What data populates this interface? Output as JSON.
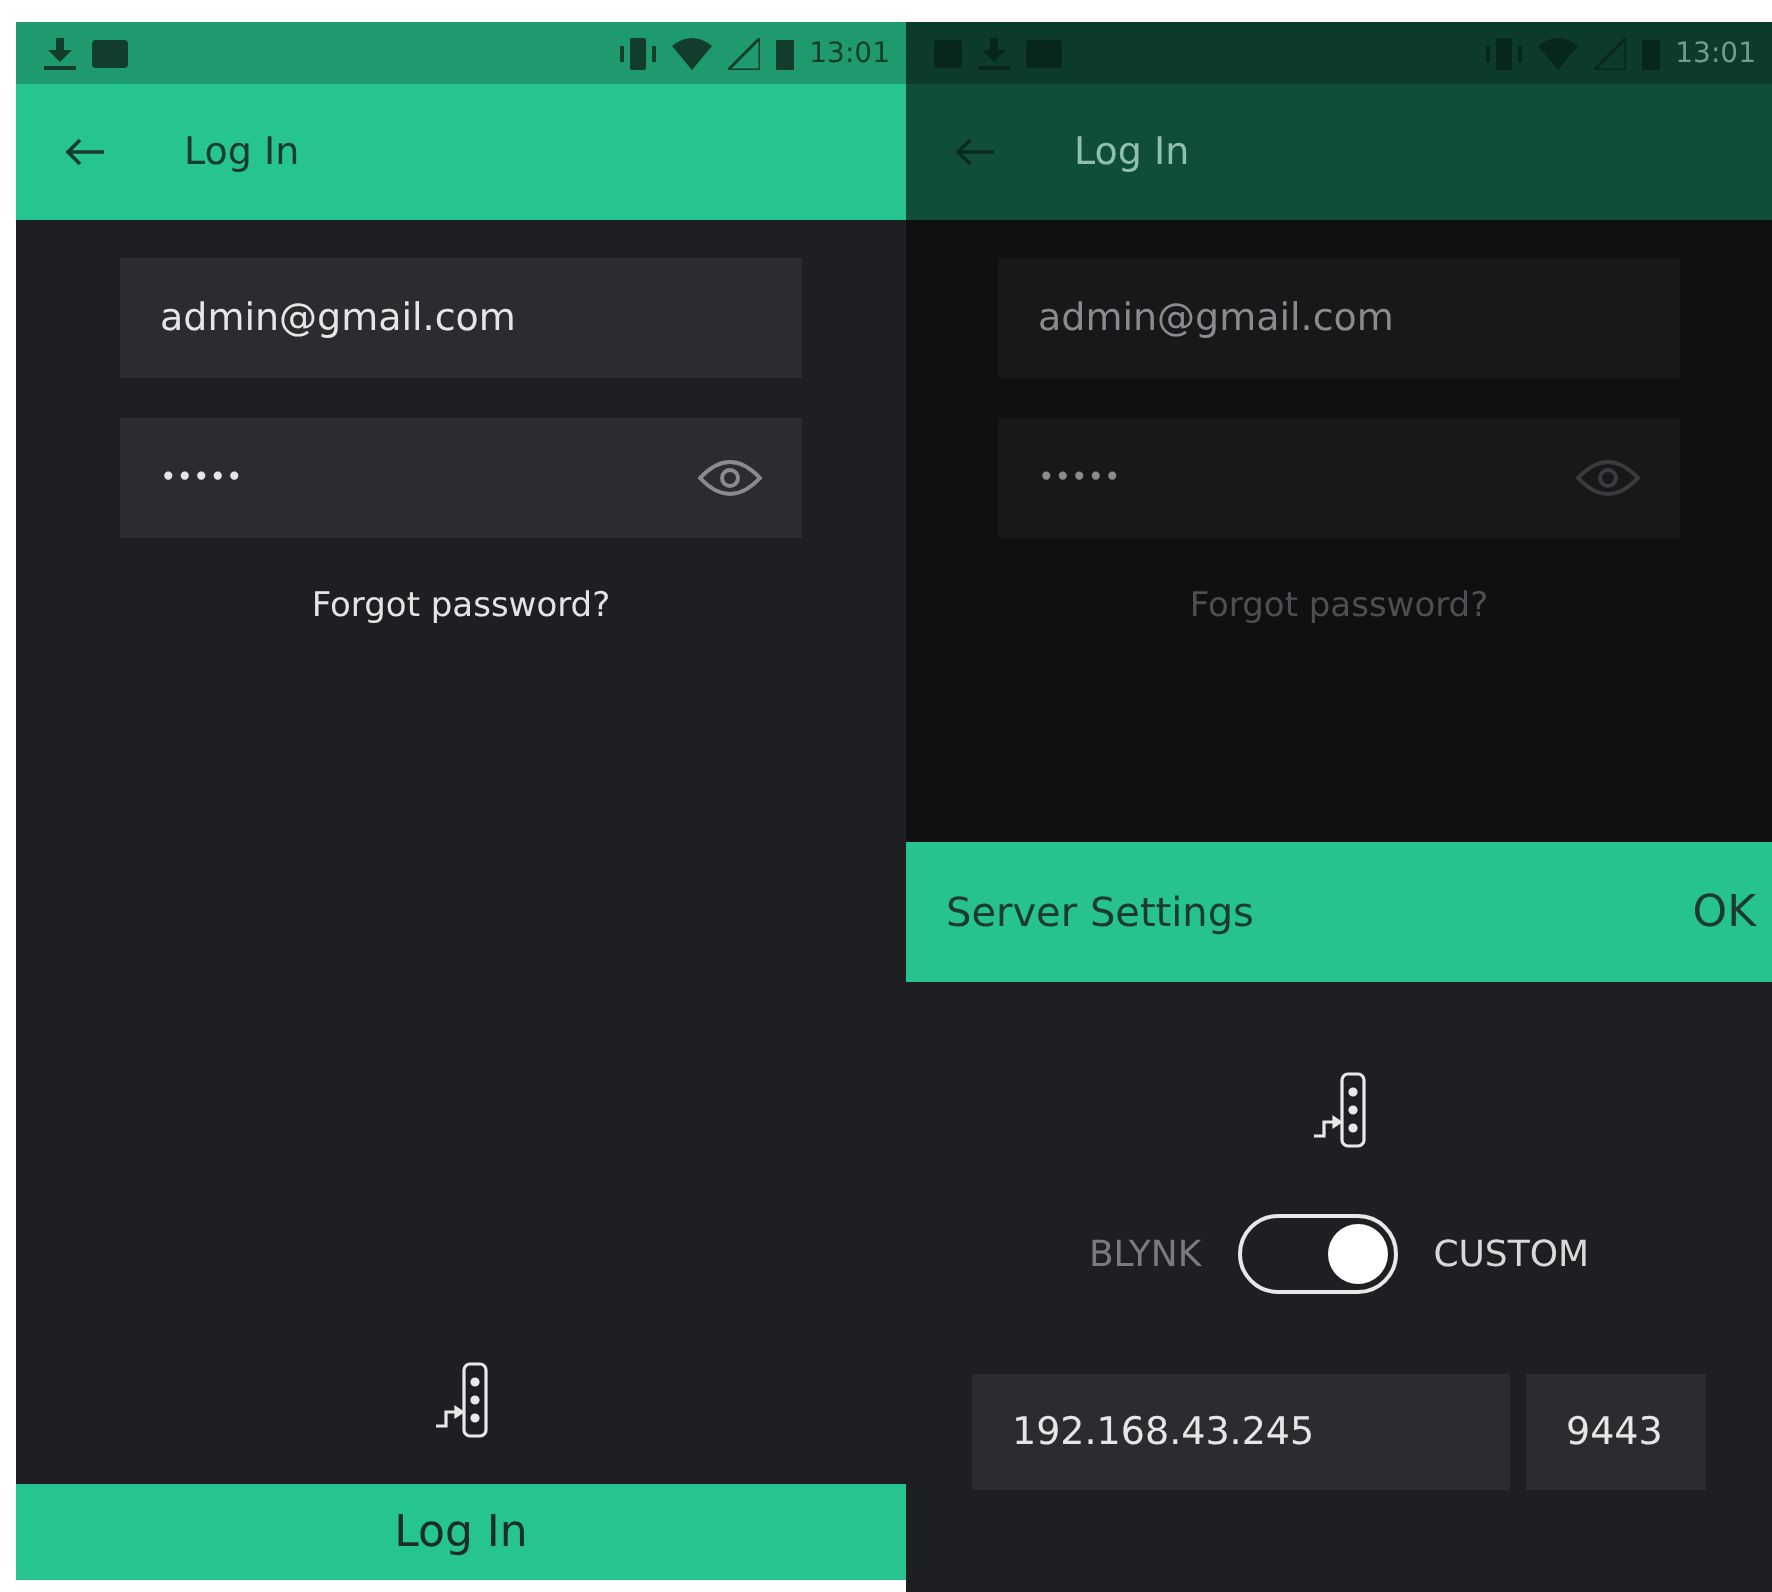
{
  "screens": [
    {
      "dimmed": false,
      "status_bar": {
        "time": "13:01"
      },
      "app_bar": {
        "title": "Log In"
      },
      "email": {
        "value": "admin@gmail.com"
      },
      "password": {
        "value": "•••••"
      },
      "forgot_link": "Forgot password?",
      "login_button": "Log In"
    },
    {
      "dimmed": true,
      "status_bar": {
        "time": "13:01"
      },
      "app_bar": {
        "title": "Log In"
      },
      "email": {
        "value": "admin@gmail.com"
      },
      "password": {
        "value": "•••••"
      },
      "forgot_link": "Forgot password?",
      "dialog": {
        "title": "Server Settings",
        "ok": "OK",
        "toggle": {
          "left_label": "BLYNK",
          "right_label": "CUSTOM",
          "on": true
        },
        "host": {
          "value": "192.168.43.245"
        },
        "port": {
          "value": "9443"
        }
      }
    }
  ]
}
